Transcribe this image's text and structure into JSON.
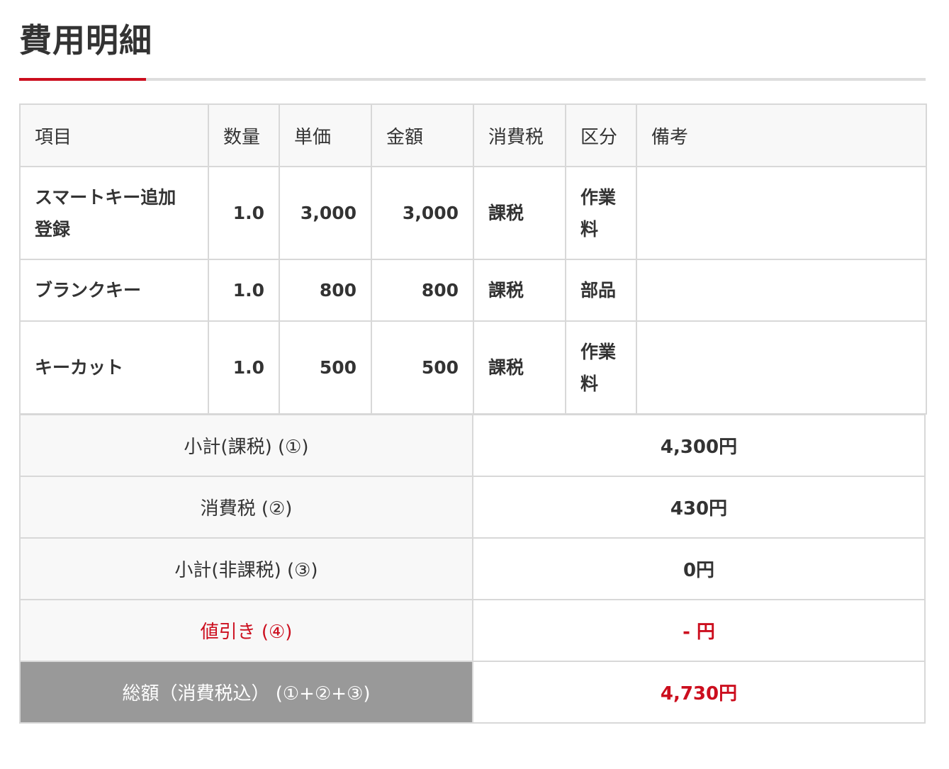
{
  "title": "費用明細",
  "table": {
    "headers": [
      "項目",
      "数量",
      "単価",
      "金額",
      "消費税",
      "区分",
      "備考"
    ],
    "rows": [
      {
        "item": "スマートキー追加登録",
        "qty": "1.0",
        "unit_price": "3,000",
        "amount": "3,000",
        "tax": "課税",
        "category": "作業料",
        "note": ""
      },
      {
        "item": "ブランクキー",
        "qty": "1.0",
        "unit_price": "800",
        "amount": "800",
        "tax": "課税",
        "category": "部品",
        "note": ""
      },
      {
        "item": "キーカット",
        "qty": "1.0",
        "unit_price": "500",
        "amount": "500",
        "tax": "課税",
        "category": "作業料",
        "note": ""
      }
    ]
  },
  "totals": {
    "subtotal_taxable": {
      "label": "小計(課税) (①)",
      "value": "4,300円"
    },
    "consumption_tax": {
      "label": "消費税 (②)",
      "value": "430円"
    },
    "subtotal_nontaxable": {
      "label": "小計(非課税) (③)",
      "value": "0円"
    },
    "discount": {
      "label": "値引き (④)",
      "value": "- 円"
    },
    "grand_total": {
      "label": "総額（消費税込） (①+②+③)",
      "value": "4,730円"
    }
  },
  "colors": {
    "accent": "#cc0e1e",
    "grand_total_label_bg": "#999999",
    "header_bg": "#f8f8f8",
    "border": "#d8d8d8"
  }
}
